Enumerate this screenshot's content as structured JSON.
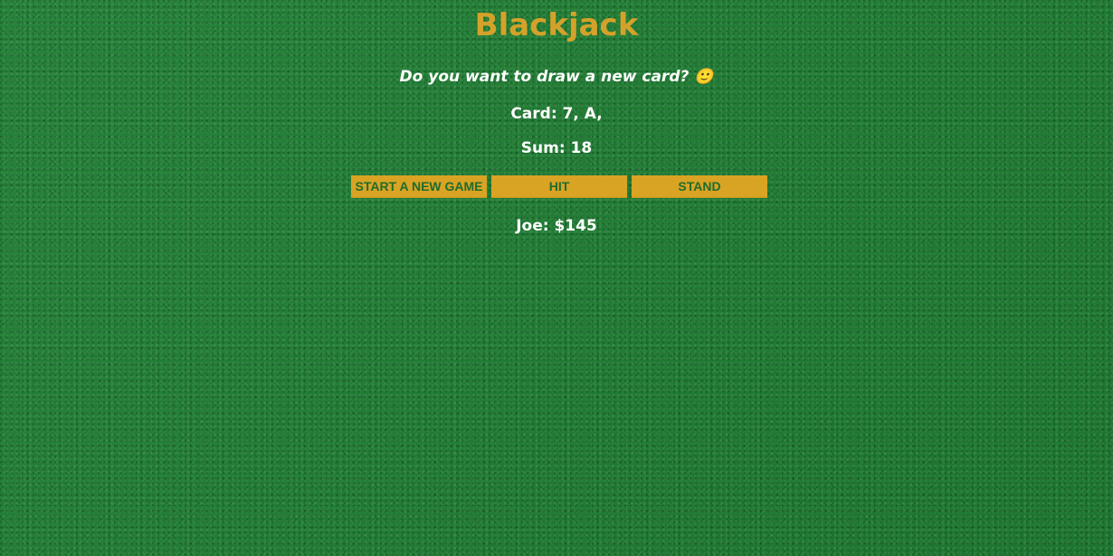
{
  "game": {
    "title": "Blackjack",
    "message": "Do you want to draw a new card? 🙂",
    "cards_text": "Card: 7, A,",
    "sum_text": "Sum: 18",
    "player_text": "Joe: $145"
  },
  "buttons": {
    "new_game": "START A NEW GAME",
    "hit": "HIT",
    "stand": "STAND"
  },
  "colors": {
    "title": "#d4a22a",
    "button_bg": "#d9a323",
    "button_text": "#1f6c2d",
    "table_bg": "#1e7d32"
  }
}
